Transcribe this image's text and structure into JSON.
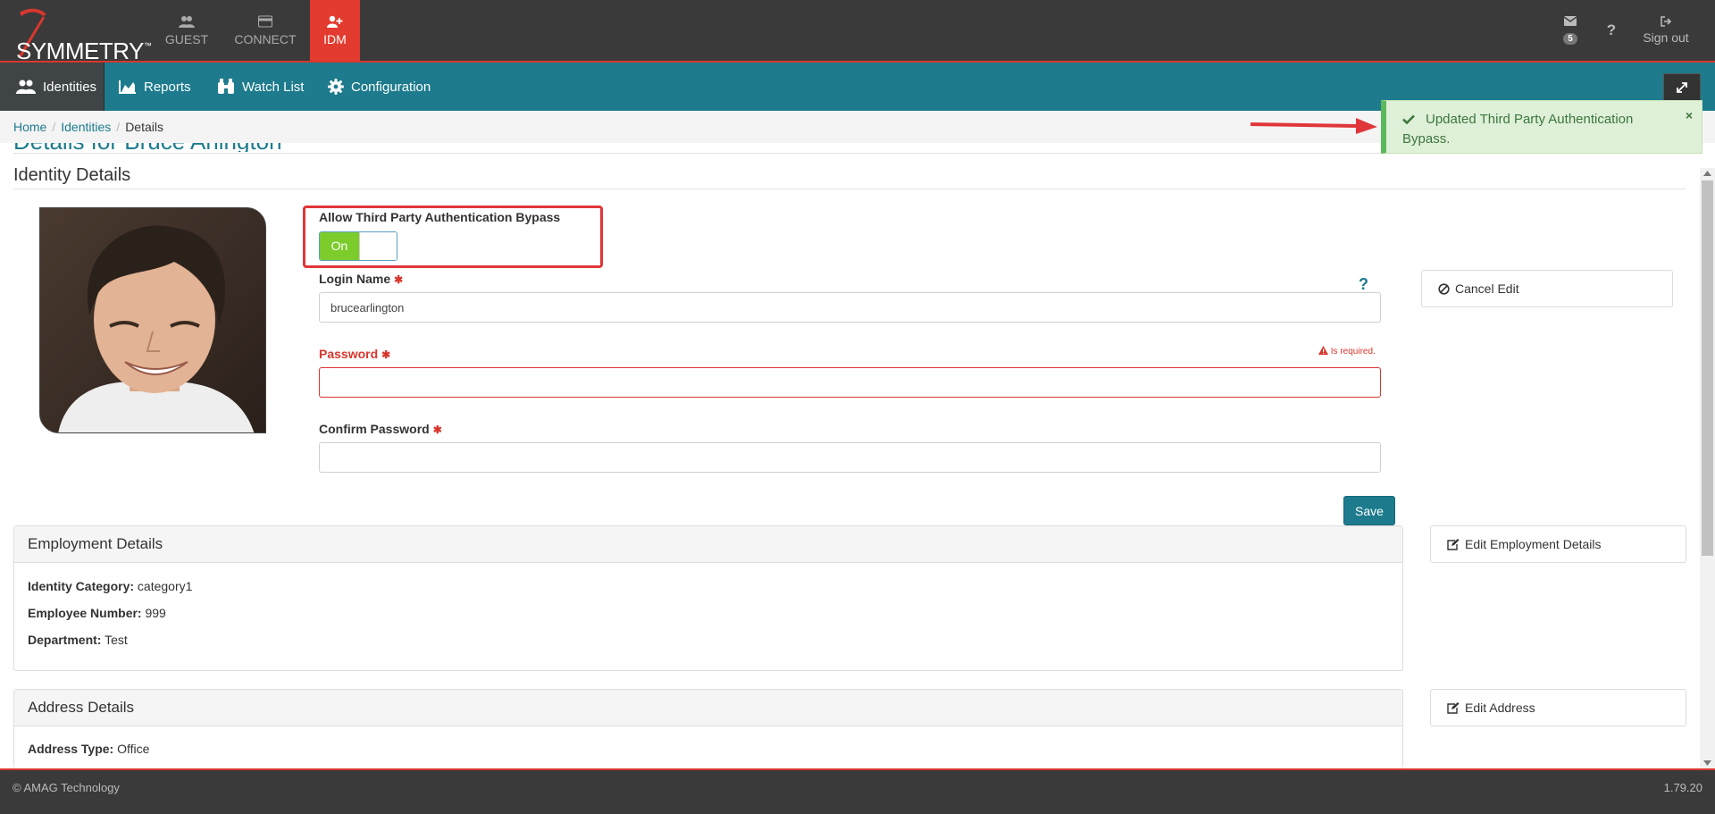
{
  "brand": {
    "name": "SYMMETRY",
    "tm": "™"
  },
  "app_tabs": [
    {
      "label": "GUEST",
      "icon": "users-icon"
    },
    {
      "label": "CONNECT",
      "icon": "card-icon"
    },
    {
      "label": "IDM",
      "icon": "user-plus-icon",
      "active": true
    }
  ],
  "top_right": {
    "mail_count": "5",
    "help": "?",
    "sign_out": "Sign out"
  },
  "nav": {
    "items": [
      {
        "label": "Identities",
        "icon": "users-icon",
        "active": true
      },
      {
        "label": "Reports",
        "icon": "area-chart-icon"
      },
      {
        "label": "Watch List",
        "icon": "binoculars-icon"
      },
      {
        "label": "Configuration",
        "icon": "gear-icon"
      }
    ]
  },
  "breadcrumb": {
    "home": "Home",
    "identities": "Identities",
    "current": "Details",
    "sep": "/"
  },
  "page_title": "Details for Bruce Arlington",
  "section_title": "Identity Details",
  "form": {
    "bypass_label": "Allow Third Party Authentication Bypass",
    "toggle_on": "On",
    "login_label": "Login Name",
    "login_value": "brucearlington",
    "password_label": "Password",
    "password_error": "Is required.",
    "confirm_label": "Confirm Password",
    "required_mark": "✱",
    "help": "?",
    "save": "Save",
    "cancel_edit": "Cancel Edit"
  },
  "employment": {
    "title": "Employment Details",
    "edit": "Edit Employment Details",
    "category_label": "Identity Category:",
    "category": "category1",
    "number_label": "Employee Number:",
    "number": "999",
    "department_label": "Department:",
    "department": "Test"
  },
  "address": {
    "title": "Address Details",
    "edit": "Edit Address",
    "type_label": "Address Type:",
    "type": "Office"
  },
  "footer": {
    "copyright": "© AMAG Technology",
    "version": "1.79.20"
  },
  "toast": {
    "message": "Updated Third Party Authentication Bypass.",
    "close": "×"
  },
  "colors": {
    "teal": "#1d7b8d",
    "red": "#e33b2f",
    "green": "#7ccd2c",
    "toast_bg": "#dff0d8"
  }
}
